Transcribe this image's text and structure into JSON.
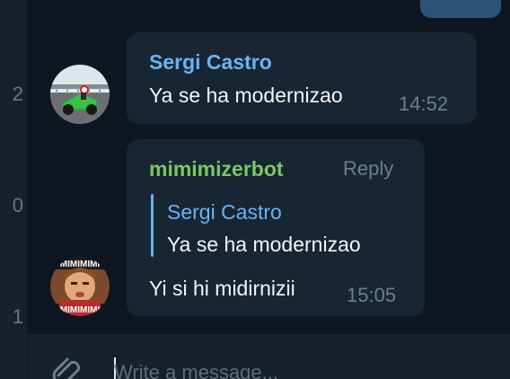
{
  "sidebar": {
    "counts": [
      "2",
      "0",
      "1"
    ]
  },
  "messages": [
    {
      "sender": "Sergi Castro",
      "sender_color": "#6ab3f3",
      "text": "Ya se ha modernizao",
      "time": "14:52",
      "avatar": "motorcycle-avatar"
    },
    {
      "sender": "mimimizerbot",
      "sender_color": "#7bc862",
      "reply_label": "Reply",
      "quote": {
        "sender": "Sergi Castro",
        "text": "Ya se ha modernizao"
      },
      "text": "Yi si hi midirnizii",
      "time": "15:05",
      "avatar": "mimimi-avatar",
      "avatar_caption": "MIMIMIMI"
    }
  ],
  "composer": {
    "placeholder": "Write a message..."
  },
  "colors": {
    "background": "#0e1621",
    "bubble": "#182533",
    "outgoing_bubble": "#2b5278",
    "accent": "#64b5ef"
  }
}
